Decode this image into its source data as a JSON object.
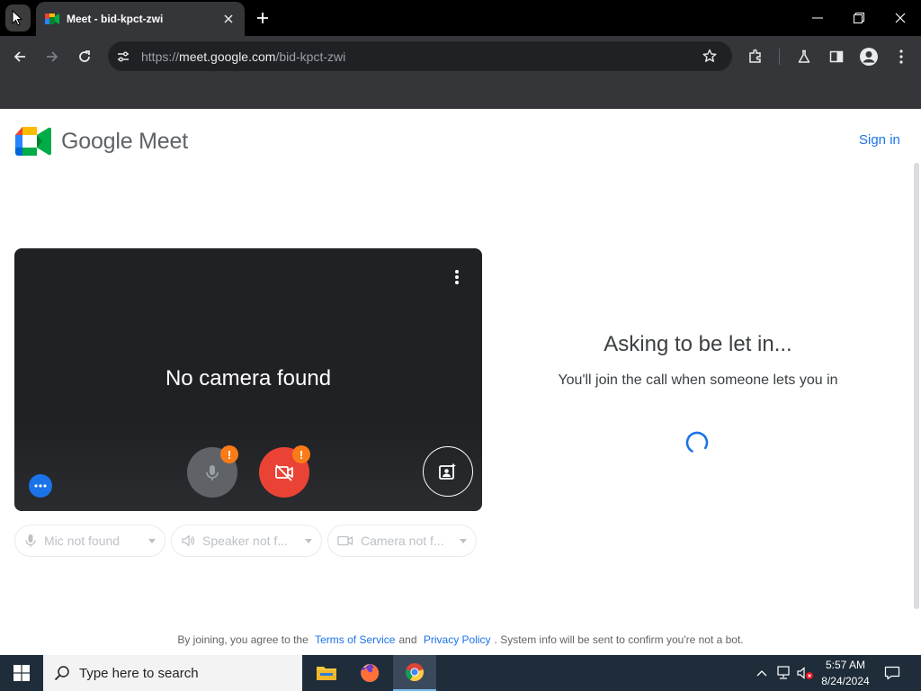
{
  "browser": {
    "tab_title": "Meet - bid-kpct-zwi",
    "url_prefix": "https://",
    "url_domain": "meet.google.com",
    "url_path": "/bid-kpct-zwi"
  },
  "header": {
    "logo_text": "Google Meet",
    "signin_label": "Sign in"
  },
  "preview": {
    "no_camera_text": "No camera found",
    "warning_badge": "!"
  },
  "devices": {
    "mic": "Mic not found",
    "speaker": "Speaker not f...",
    "camera": "Camera not f..."
  },
  "status": {
    "title": "Asking to be let in...",
    "subtitle": "You'll join the call when someone lets you in"
  },
  "footer": {
    "prefix": "By joining, you agree to the",
    "terms": "Terms of Service",
    "and": "and",
    "privacy": "Privacy Policy",
    "suffix": ". System info will be sent to confirm you're not a bot."
  },
  "taskbar": {
    "search_placeholder": "Type here to search",
    "time": "5:57 AM",
    "date": "8/24/2024"
  },
  "colors": {
    "accent": "#1a73e8",
    "cam_off": "#ea4335",
    "warning": "#fa7b17",
    "preview_bg": "#202124"
  },
  "icons": [
    "meet-logo-icon",
    "mic-off-icon",
    "camera-off-icon",
    "visual-effects-icon",
    "more-options-icon",
    "speaker-icon",
    "spinner-icon"
  ]
}
